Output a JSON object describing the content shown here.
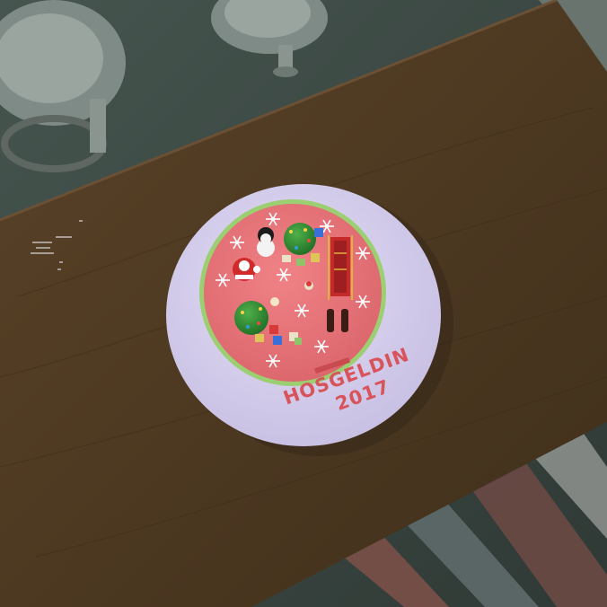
{
  "scene": {
    "title": "",
    "cake": {
      "inscription_line1": "HOSGELDIN",
      "inscription_line2": "2017",
      "frosting_color": "#e9777b",
      "plate_color": "#d6cfee",
      "border_beads_color": "#8fc46a"
    },
    "table": {
      "color": "#4f3b25"
    },
    "props": [
      "snowman",
      "santa",
      "christmas-tree",
      "christmas-tree",
      "sleigh",
      "gift-boxes",
      "boots",
      "snowflakes"
    ]
  }
}
